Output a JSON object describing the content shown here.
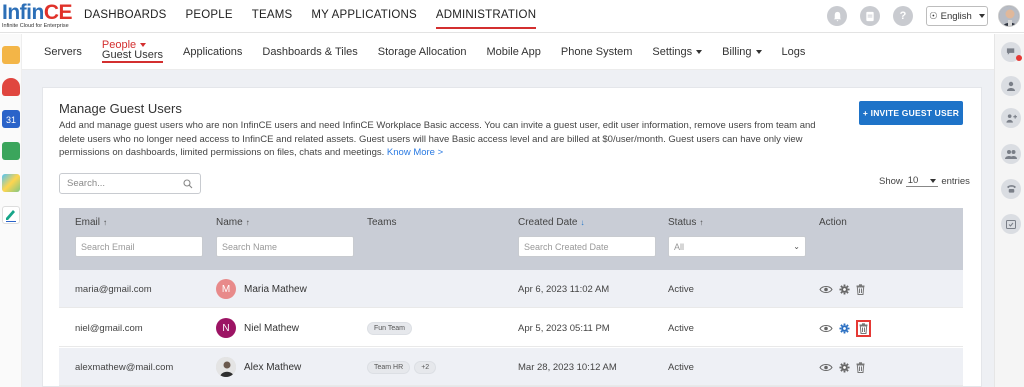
{
  "logo": {
    "brand_main": "Infin",
    "brand_accent": "CE",
    "tagline": "Infinite Cloud for Enterprise"
  },
  "topnav": [
    {
      "label": "DASHBOARDS",
      "active": false
    },
    {
      "label": "PEOPLE",
      "active": false
    },
    {
      "label": "TEAMS",
      "active": false
    },
    {
      "label": "MY APPLICATIONS",
      "active": false
    },
    {
      "label": "ADMINISTRATION",
      "active": true
    }
  ],
  "header_right": {
    "language": "English",
    "help": "?"
  },
  "subnav": {
    "servers": "Servers",
    "people_top": "People",
    "people_bottom": "Guest Users",
    "applications": "Applications",
    "dashboards_tiles": "Dashboards & Tiles",
    "storage": "Storage Allocation",
    "mobile": "Mobile App",
    "phone": "Phone System",
    "settings": "Settings",
    "billing": "Billing",
    "logs": "Logs"
  },
  "page": {
    "title": "Manage Guest Users",
    "description": "Add and manage guest users who are non InfinCE users and need InfinCE Workplace Basic access. You can invite a guest user, edit user information, remove users from team and delete users who no longer need access to InfinCE and related assets. Guest users will have Basic access level and are billed at $0/user/month. Guest users can have only view permissions on dashboards, limited permissions on files, chats and meetings.",
    "know_more": "Know More >",
    "invite_button": "+ INVITE GUEST USER",
    "search_placeholder": "Search...",
    "show_label": "Show",
    "show_value": "10",
    "entries_label": "entries"
  },
  "table": {
    "columns": {
      "email": "Email",
      "name": "Name",
      "teams": "Teams",
      "created": "Created Date",
      "status": "Status",
      "action": "Action"
    },
    "filters": {
      "email": "Search Email",
      "name": "Search Name",
      "created": "Search Created Date",
      "status": "All"
    },
    "rows": [
      {
        "email": "maria@gmail.com",
        "initial": "M",
        "avatar_color": "#e88a8a",
        "name": "Maria Mathew",
        "teams": [],
        "created": "Apr 6, 2023 11:02 AM",
        "status": "Active"
      },
      {
        "email": "niel@gmail.com",
        "initial": "N",
        "avatar_color": "#9c1464",
        "name": "Niel Mathew",
        "teams": [
          "Fun Team"
        ],
        "created": "Apr 5, 2023 05:11 PM",
        "status": "Active"
      },
      {
        "email": "alexmathew@mail.com",
        "initial": "",
        "avatar_color": "#6b6b6b",
        "name": "Alex Mathew",
        "teams": [
          "Team HR",
          "+2"
        ],
        "created": "Mar 28, 2023 10:12 AM",
        "status": "Active"
      }
    ]
  },
  "colors": {
    "accent_red": "#d32f2f",
    "primary_blue": "#1e73c8",
    "header_gray": "#c9cdd6"
  }
}
